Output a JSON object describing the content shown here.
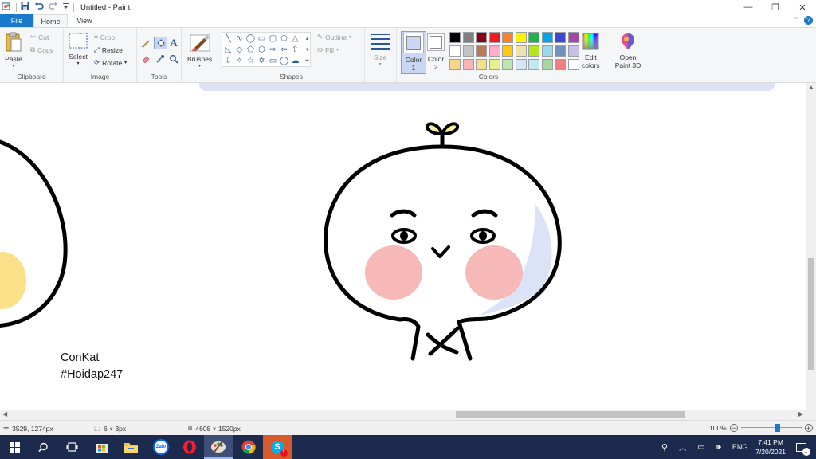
{
  "window": {
    "title": "Untitled - Paint",
    "controls": {
      "minimize": "—",
      "maximize": "❐",
      "close": "✕"
    }
  },
  "quick_access": {
    "icons": [
      "paint-app-icon",
      "save-icon",
      "undo-icon",
      "redo-icon",
      "customize-icon"
    ]
  },
  "tabs": {
    "file": "File",
    "home": "Home",
    "view": "View"
  },
  "help": {
    "collapse": "⌃",
    "help_icon": "?"
  },
  "ribbon": {
    "clipboard": {
      "label": "Clipboard",
      "paste": "Paste",
      "cut": "Cut",
      "copy": "Copy"
    },
    "image": {
      "label": "Image",
      "select": "Select",
      "crop": "Crop",
      "resize": "Resize",
      "rotate": "Rotate"
    },
    "tools": {
      "label": "Tools"
    },
    "brushes": {
      "label": "Brushes"
    },
    "shapes": {
      "label": "Shapes",
      "outline": "Outline",
      "fill": "Fill"
    },
    "size": {
      "label": "Size"
    },
    "colors": {
      "label": "Colors",
      "color1": "Color\n1",
      "color1_l1": "Color",
      "color1_l2": "1",
      "color2_l1": "Color",
      "color2_l2": "2",
      "edit_l1": "Edit",
      "edit_l2": "colors",
      "palette": [
        "#000000",
        "#7f7f7f",
        "#880015",
        "#ed1c24",
        "#ff7f27",
        "#fff200",
        "#22b14c",
        "#00a2e8",
        "#3f48cc",
        "#a349a4",
        "#ffffff",
        "#c3c3c3",
        "#b97a57",
        "#ffaec9",
        "#ffc90e",
        "#efe4b0",
        "#b5e61d",
        "#99d9ea",
        "#7092be",
        "#c8bfe7",
        "#f5d78a",
        "#f7b6b6",
        "#f5e08a",
        "#e8ef8e",
        "#bfe6b0",
        "#d6e6f5",
        "#bfe9ef",
        "#a8d8a0",
        "#f08080",
        "#ffffff"
      ],
      "color1_value": "#c9d7f4",
      "color2_value": "#ffffff"
    },
    "paint3d": {
      "l1": "Open",
      "l2": "Paint 3D"
    }
  },
  "canvas": {
    "text_line1": "ConKat",
    "text_line2": "#Hoidap247",
    "colors": {
      "outline": "#000000",
      "cheek": "#f7b8b8",
      "shade": "#dde3f7",
      "egg_yolk": "#fbe08a",
      "sprout": "#f3f0a0"
    }
  },
  "status": {
    "cursor": "3529, 1274px",
    "selection": "6 × 3px",
    "image_size": "4608 × 1520px",
    "zoom": "100%",
    "zoom_fraction": 0.62
  },
  "taskbar": {
    "apps": [
      "windows-start-icon",
      "search-icon",
      "task-view-icon",
      "store-icon",
      "file-explorer-icon",
      "zalo-icon",
      "opera-icon",
      "paint-brush-icon",
      "chrome-icon",
      "skype-icon"
    ],
    "zalo_label": "Zalo",
    "lang": "ENG",
    "time": "7:41 PM",
    "date": "7/20/2021",
    "notifications": "1"
  }
}
